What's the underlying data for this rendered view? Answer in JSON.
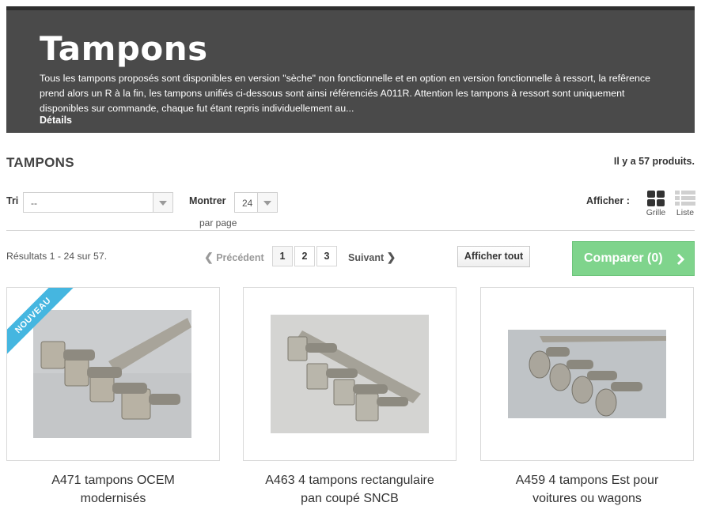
{
  "banner": {
    "title": "Tampons",
    "description": "Tous les tampons proposés sont disponibles en version \"sèche\" non fonctionnelle et en option en version fonctionnelle à ressort, la refêrence prend alors un R à la fin, les tampons unifiés ci-dessous sont ainsi référenciés A011R. Attention les tampons à ressort sont uniquement disponibles sur commande, chaque fut étant repris individuellement au...",
    "details_label": "Détails"
  },
  "category": {
    "heading": "TAMPONS",
    "count_text": "Il y a 57 produits."
  },
  "toolbar": {
    "sort_label": "Tri",
    "sort_value": "--",
    "show_label": "Montrer",
    "show_value": "24",
    "per_page_label": "par page",
    "view_label": "Afficher :",
    "grid_label": "Grille",
    "list_label": "Liste"
  },
  "pagination": {
    "results_text": "Résultats 1 - 24 sur 57.",
    "prev_label": "Précédent",
    "next_label": "Suivant",
    "pages": [
      "1",
      "2",
      "3"
    ],
    "current_page": "1",
    "show_all_label": "Afficher tout",
    "compare_label": "Comparer (0)"
  },
  "products": [
    {
      "name_line1": "A471 tampons OCEM",
      "name_line2": "modernisés",
      "badge": "NOUVEAU"
    },
    {
      "name_line1": "A463 4 tampons rectangulaire",
      "name_line2": "pan coupé SNCB",
      "badge": ""
    },
    {
      "name_line1": "A459 4 tampons Est pour",
      "name_line2": "voitures ou wagons",
      "badge": ""
    }
  ],
  "colors": {
    "banner_bg": "#4a4a4a",
    "compare_button": "#7fd48c",
    "new_ribbon": "#45b6e0"
  }
}
